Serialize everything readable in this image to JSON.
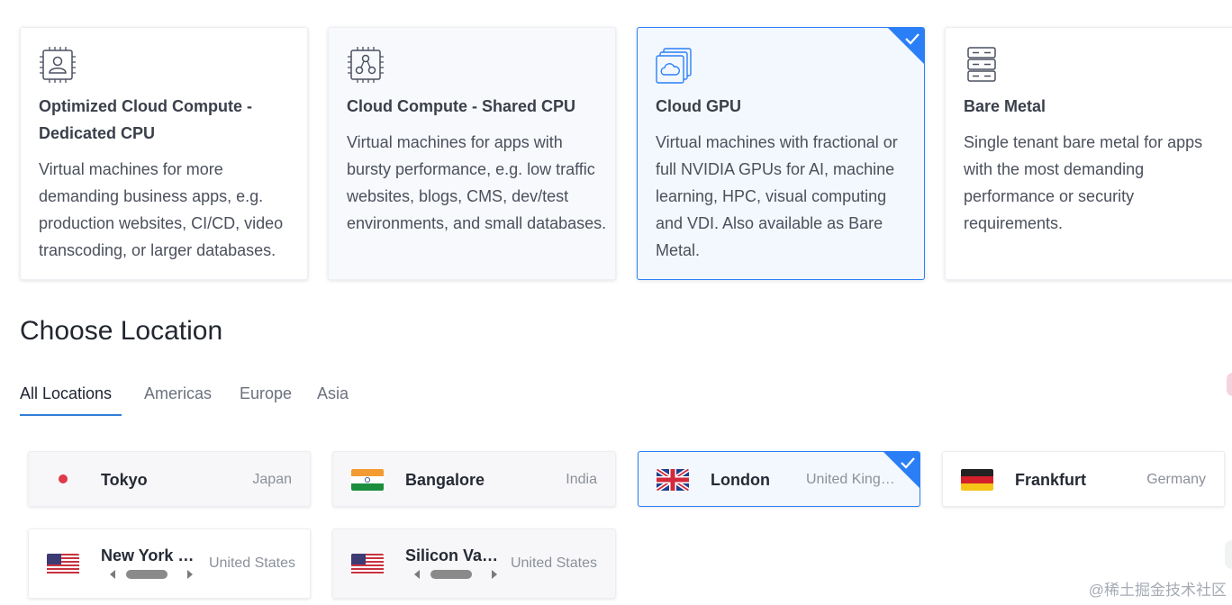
{
  "products": [
    {
      "title": "Optimized Cloud Compute - Dedicated CPU",
      "description": "Virtual machines for more demanding business apps, e.g. production websites, CI/CD, video transcoding, or larger databases.",
      "icon": "chip-user-icon"
    },
    {
      "title": "Cloud Compute - Shared CPU",
      "description": "Virtual machines for apps with bursty performance, e.g. low traffic websites, blogs, CMS, dev/test environments, and small databases.",
      "icon": "chip-nodes-icon"
    },
    {
      "title": "Cloud GPU",
      "description": "Virtual machines with fractional or full NVIDIA GPUs for AI, machine learning, HPC, visual computing and VDI. Also available as Bare Metal.",
      "icon": "gpu-cloud-icon",
      "selected": true
    },
    {
      "title": "Bare Metal",
      "description": "Single tenant bare metal for apps with the most demanding performance or security requirements.",
      "icon": "server-stack-icon"
    }
  ],
  "location_section": {
    "title": "Choose Location",
    "tabs": [
      "All Locations",
      "Americas",
      "Europe",
      "Asia"
    ],
    "active_tab": "All Locations"
  },
  "locations": [
    {
      "city": "Tokyo",
      "country": "Japan",
      "flag": "japan-flag-icon"
    },
    {
      "city": "Bangalore",
      "country": "India",
      "flag": "india-flag-icon"
    },
    {
      "city": "London",
      "country": "United Kingdom",
      "flag": "uk-flag-icon",
      "selected": true
    },
    {
      "city": "Frankfurt",
      "country": "Germany",
      "flag": "germany-flag-icon"
    },
    {
      "city": "New York (NJ)",
      "country": "United States",
      "flag": "us-flag-icon"
    },
    {
      "city": "Silicon Valley",
      "country": "United States",
      "flag": "us-flag-icon"
    }
  ],
  "watermark": "@稀土掘金技术社区",
  "colors": {
    "accent": "#2b7ff6",
    "tab_underline": "#2f7fd6",
    "text_dark": "#22262f",
    "text_muted": "#8b909a"
  }
}
